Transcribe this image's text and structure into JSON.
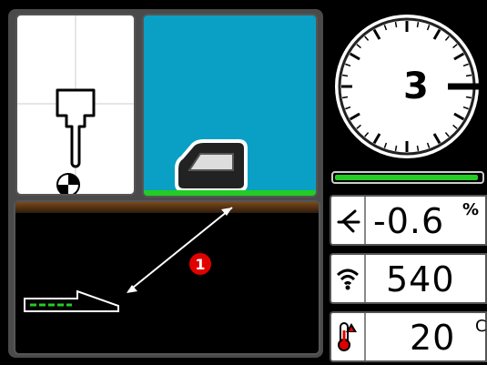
{
  "gauge": {
    "gear_value": "3"
  },
  "level_bar": {
    "fill_fraction": 0.98,
    "color": "#22cc22"
  },
  "readouts": [
    {
      "icon": "slope-icon",
      "value": "-0.6",
      "unit": "%"
    },
    {
      "icon": "wifi-signal-icon",
      "value": "540",
      "unit": ""
    },
    {
      "icon": "thermometer-icon",
      "value": "20",
      "unit": "C"
    }
  ],
  "marker": {
    "label": "1",
    "color": "#e00000"
  },
  "colors": {
    "sky": "#0aa0c6",
    "grass": "#22cc22",
    "frame": "#4a4a4a"
  }
}
